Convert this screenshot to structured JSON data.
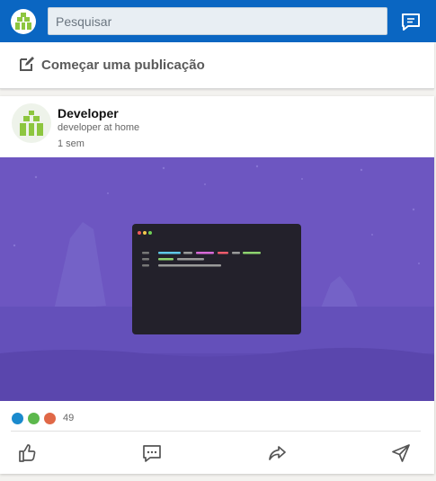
{
  "topbar": {
    "logo_icon": "company-logo-icon",
    "search": {
      "placeholder": "Pesquisar",
      "value": ""
    },
    "messaging_icon": "chat-bubble-icon",
    "brand_color": "#0a66c2"
  },
  "composer": {
    "icon": "pencil-edit-icon",
    "label": "Começar uma publicação"
  },
  "post": {
    "author": "Developer",
    "headline": "developer at home",
    "time": "1 sem",
    "media_icon": "code-editor-illustration",
    "reactions": {
      "colors": [
        "#1a8acd",
        "#5cb84c",
        "#e06847"
      ],
      "count": "49"
    },
    "actions": [
      {
        "name": "like",
        "icon": "thumbs-up-icon"
      },
      {
        "name": "comment",
        "icon": "comment-icon"
      },
      {
        "name": "share",
        "icon": "share-arrow-icon"
      },
      {
        "name": "send",
        "icon": "send-icon"
      }
    ]
  }
}
